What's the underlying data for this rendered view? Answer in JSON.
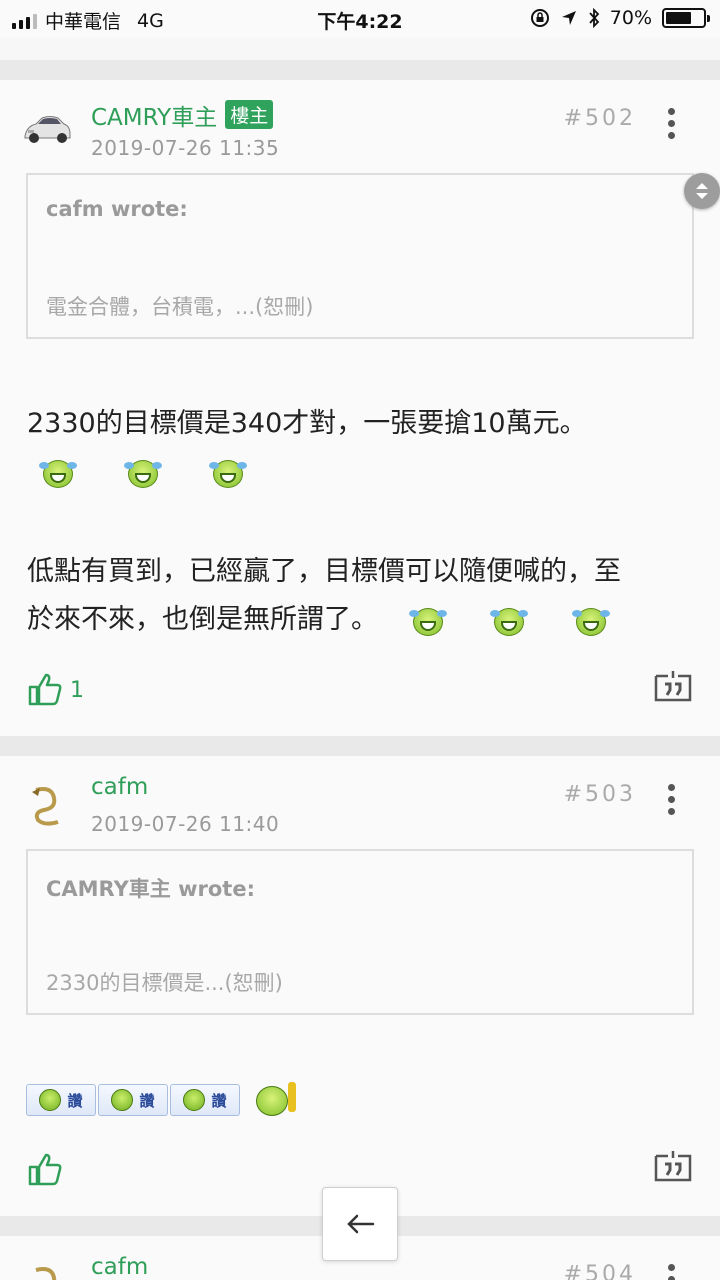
{
  "status_bar": {
    "carrier": "中華電信",
    "network": "4G",
    "time": "下午4:22",
    "battery": "70%",
    "battery_level": 0.7
  },
  "posts": [
    {
      "author": "CAMRY車主",
      "op_badge": "樓主",
      "date": "2019-07-26 11:35",
      "number": "#502",
      "quote_author": "cafm wrote:",
      "quote_text": "電金合體，台積電，...(恕刪)",
      "paragraph1": "2330的目標價是340才對，一張要搶10萬元。",
      "paragraph2": "低點有買到，已經贏了，目標價可以隨便喊的，至",
      "paragraph3": "於來不來，也倒是無所謂了。",
      "likes": "1"
    },
    {
      "author": "cafm",
      "date": "2019-07-26 11:40",
      "number": "#503",
      "quote_author": "CAMRY車主 wrote:",
      "quote_text": "2330的目標價是...(恕刪)",
      "sticker_label": "讚"
    },
    {
      "author": "cafm",
      "number": "#504"
    }
  ]
}
